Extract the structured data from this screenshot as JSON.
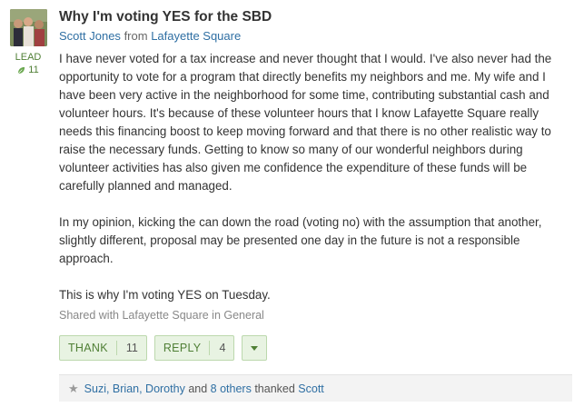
{
  "post": {
    "title": "Why I'm voting YES for the SBD",
    "author": "Scott Jones",
    "from_word": "from",
    "neighborhood": "Lafayette Square",
    "lead_label": "LEAD",
    "lead_count": "11",
    "paragraphs": [
      "I have never voted for a tax increase and never thought that I would. I've also never had the opportunity to vote for a program that directly benefits my neighbors and me. My wife and I have been very active in the neighborhood for some time, contributing substantial cash and volunteer hours. It's because of these volunteer hours that I know Lafayette Square really needs this financing boost to keep moving forward and that there is no other realistic way to raise the necessary funds. Getting to know so many of our wonderful neighbors during volunteer activities has also given me confidence the expenditure of these funds will be carefully planned and managed.",
      "In my opinion, kicking the can down the road (voting no) with the assumption that another, slightly different, proposal may be presented one day in the future is not a responsible approach.",
      "This is why I'm voting YES on Tuesday."
    ],
    "shared_with": "Shared with Lafayette Square in General"
  },
  "actions": {
    "thank_label": "THANK",
    "thank_count": "11",
    "reply_label": "REPLY",
    "reply_count": "4"
  },
  "thanked": {
    "names": "Suzi, Brian, Dorothy",
    "and_word": "and",
    "others": "8 others",
    "thanked_word": "thanked",
    "target": "Scott"
  },
  "colors": {
    "link": "#2f6fa3",
    "accent_green": "#4f7f35",
    "button_bg": "#e8f3e2"
  }
}
